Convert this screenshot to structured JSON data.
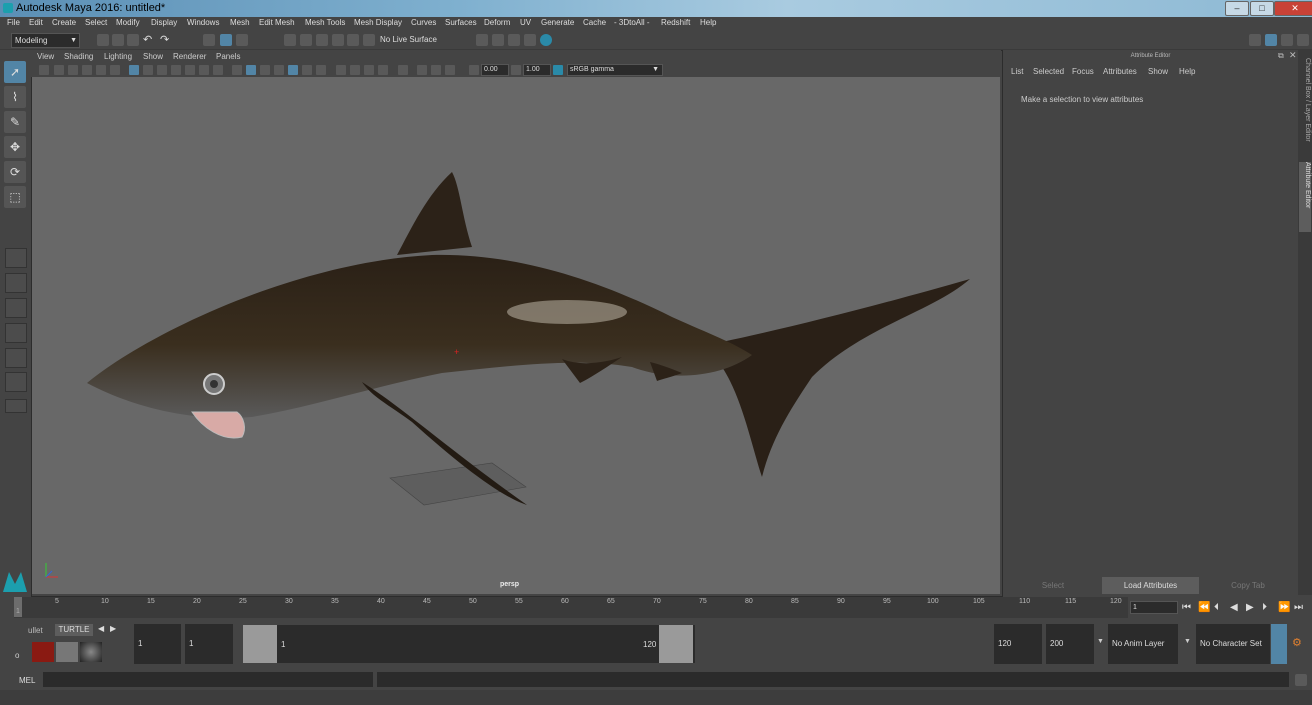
{
  "window": {
    "title": "Autodesk Maya 2016: untitled*",
    "min": "–",
    "max": "□",
    "close": "✕"
  },
  "menubar": [
    "File",
    "Edit",
    "Create",
    "Select",
    "Modify",
    "Display",
    "Windows",
    "Mesh",
    "Edit Mesh",
    "Mesh Tools",
    "Mesh Display",
    "Curves",
    "Surfaces",
    "Deform",
    "UV",
    "Generate",
    "Cache",
    "- 3DtoAll -",
    "Redshift",
    "Help"
  ],
  "status": {
    "menuset": "Modeling",
    "live_surface": "No Live Surface"
  },
  "viewport": {
    "menu": [
      "View",
      "Shading",
      "Lighting",
      "Show",
      "Renderer",
      "Panels"
    ],
    "exposure": "0.00",
    "gamma": "1.00",
    "colorspace": "sRGB gamma",
    "camera_label": "persp"
  },
  "attribute_editor": {
    "header": "Attribute Editor",
    "menu": [
      "List",
      "Selected",
      "Focus",
      "Attributes",
      "Show",
      "Help"
    ],
    "message": "Make a selection to view attributes",
    "buttons": {
      "select": "Select",
      "load": "Load Attributes",
      "copy": "Copy Tab"
    },
    "side_tabs": [
      "Channel Box / Layer Editor",
      "Attribute Editor"
    ]
  },
  "timeline": {
    "ticks": [
      "1",
      "5",
      "10",
      "15",
      "20",
      "25",
      "30",
      "35",
      "40",
      "45",
      "50",
      "55",
      "60",
      "65",
      "70",
      "75",
      "80",
      "85",
      "90",
      "95",
      "100",
      "105",
      "110",
      "115",
      "120"
    ],
    "current_frame": "1"
  },
  "range": {
    "start": "1",
    "playback_start": "1",
    "handle_start": "1",
    "handle_end": "120",
    "playback_end": "120",
    "end": "200",
    "anim_layer": "No Anim Layer",
    "character_set": "No Character Set"
  },
  "shelf": {
    "tabs": [
      "ullet",
      "TURTLE"
    ]
  },
  "cmdline": {
    "label": "MEL"
  }
}
